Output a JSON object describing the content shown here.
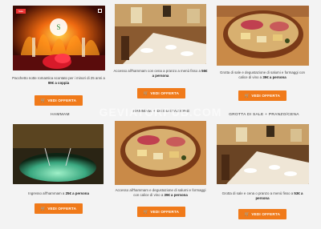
{
  "cards": [
    {
      "desc_pre": "Pacchetto notte romantica scontato per i minori di 25 anni a ",
      "desc_bold": "99€ a coppia",
      "button": "VEDI OFFERTA",
      "badge": "Sale"
    },
    {
      "desc_pre": "Accesso all'hammam con cena a pranzo a menù fisso a ",
      "desc_bold": "56€ a persona",
      "button": "VEDI OFFERTA"
    },
    {
      "desc_pre": "Grotta di sale e degustazione di salumi e formaggi con calice di vino a ",
      "desc_bold": "39€ a persona",
      "button": "VEDI OFFERTA"
    },
    {
      "desc_pre": "Ingresso all'hammam a ",
      "desc_bold": "25€ a persona",
      "button": "VEDI OFFERTA"
    },
    {
      "desc_pre": "Accesso all'hammam e degustazione di salumi e formaggi con calice di vino a ",
      "desc_bold": "39€ a persona",
      "button": "VEDI OFFERTA"
    },
    {
      "desc_pre": "Grotta di sale e cena o pranzo a menù fisso a ",
      "desc_bold": "53€ a persona",
      "button": "VEDI OFFERTA"
    }
  ],
  "section_titles": {
    "hammam": "HAMMAM",
    "hammam_degustazione": "HAMMAM + DEGUSTAZIONE",
    "grotta": "GROTTA DI SALE + PRANZO/CENA"
  },
  "watermark": "GEVIATORPUB.COM",
  "colors": {
    "button": "#f07a1a",
    "background": "#f3f3f3"
  },
  "icons": {
    "button_icon": "cart-icon"
  }
}
